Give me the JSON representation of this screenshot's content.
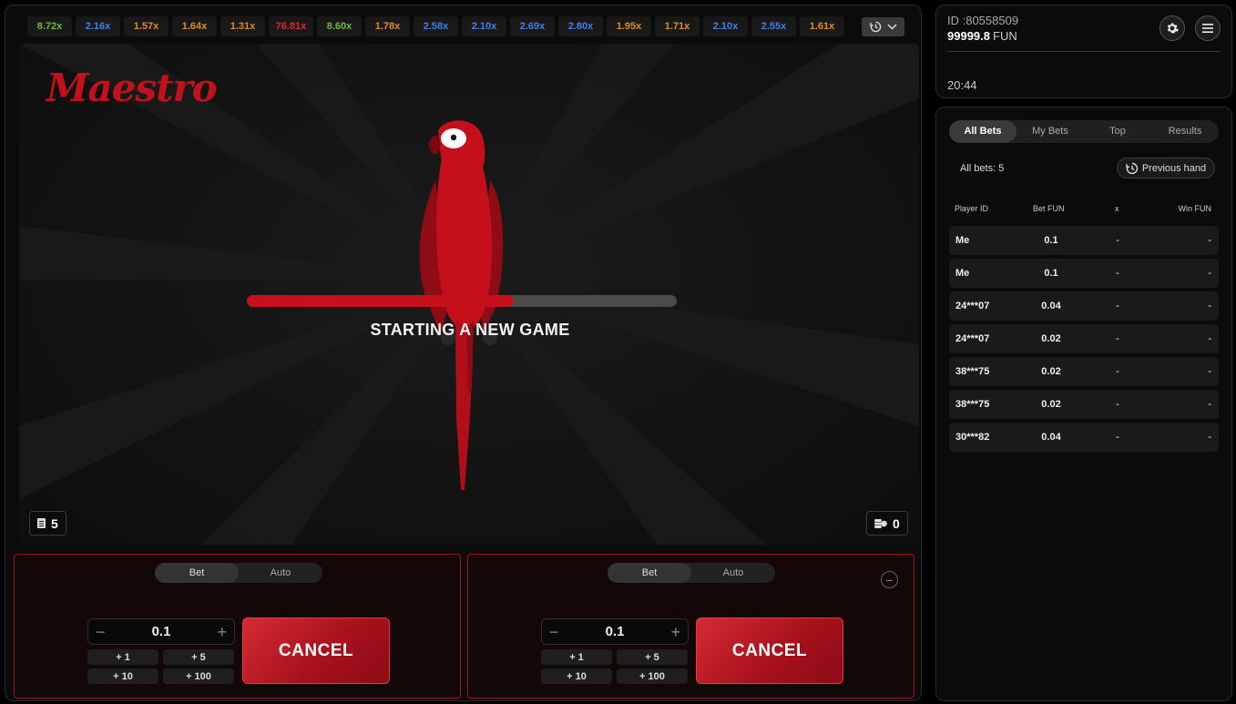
{
  "history": {
    "multipliers": [
      {
        "value": "8.72x",
        "color": "#6fb83a"
      },
      {
        "value": "2.16x",
        "color": "#3f7fe8"
      },
      {
        "value": "1.57x",
        "color": "#e08b2a"
      },
      {
        "value": "1.64x",
        "color": "#e08b2a"
      },
      {
        "value": "1.31x",
        "color": "#e08b2a"
      },
      {
        "value": "76.81x",
        "color": "#e0242f"
      },
      {
        "value": "8.60x",
        "color": "#6fb83a"
      },
      {
        "value": "1.78x",
        "color": "#e08b2a"
      },
      {
        "value": "2.58x",
        "color": "#3f7fe8"
      },
      {
        "value": "2.10x",
        "color": "#3f7fe8"
      },
      {
        "value": "2.69x",
        "color": "#3f7fe8"
      },
      {
        "value": "2.80x",
        "color": "#3f7fe8"
      },
      {
        "value": "1.95x",
        "color": "#e08b2a"
      },
      {
        "value": "1.71x",
        "color": "#e08b2a"
      },
      {
        "value": "2.10x",
        "color": "#3f7fe8"
      },
      {
        "value": "2.55x",
        "color": "#3f7fe8"
      },
      {
        "value": "1.61x",
        "color": "#e08b2a"
      }
    ],
    "history_icon": "history-icon",
    "expand_icon": "chevron-down-icon"
  },
  "stage": {
    "logo": "Maestro",
    "status": "STARTING A NEW GAME",
    "progress_fraction": 0.62,
    "players_count": "5",
    "cashed_count": "0",
    "accent": "#c8101c"
  },
  "bet_panels": [
    {
      "mode_bet": "Bet",
      "mode_auto": "Auto",
      "amount": "0.1",
      "minus": "−",
      "plus": "+",
      "quick": [
        "+ 1",
        "+ 5",
        "+ 10",
        "+ 100"
      ],
      "action": "CANCEL"
    },
    {
      "mode_bet": "Bet",
      "mode_auto": "Auto",
      "amount": "0.1",
      "minus": "−",
      "plus": "+",
      "quick": [
        "+ 1",
        "+ 5",
        "+ 10",
        "+ 100"
      ],
      "action": "CANCEL",
      "remove": "−"
    }
  ],
  "account": {
    "id": "ID :80558509",
    "balance": "99999.8",
    "currency": "FUN",
    "time": "20:44"
  },
  "bets": {
    "tabs": [
      "All Bets",
      "My Bets",
      "Top",
      "Results"
    ],
    "count_label": "All bets: 5",
    "previous_hand": "Previous hand",
    "headers": {
      "player": "Player ID",
      "bet": "Bet  FUN",
      "x": "x",
      "win": "Win  FUN"
    },
    "rows": [
      {
        "player": "Me",
        "bet": "0.1",
        "x": "-",
        "win": "-"
      },
      {
        "player": "Me",
        "bet": "0.1",
        "x": "-",
        "win": "-"
      },
      {
        "player": "24***07",
        "bet": "0.04",
        "x": "-",
        "win": "-"
      },
      {
        "player": "24***07",
        "bet": "0.02",
        "x": "-",
        "win": "-"
      },
      {
        "player": "38***75",
        "bet": "0.02",
        "x": "-",
        "win": "-"
      },
      {
        "player": "38***75",
        "bet": "0.02",
        "x": "-",
        "win": "-"
      },
      {
        "player": "30***82",
        "bet": "0.04",
        "x": "-",
        "win": "-"
      }
    ]
  }
}
